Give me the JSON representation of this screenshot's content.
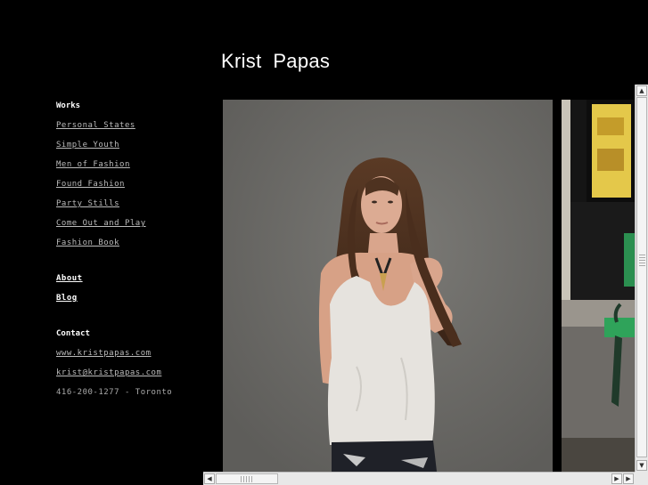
{
  "header": {
    "title": "Krist  Papas"
  },
  "sidebar": {
    "works_heading": "Works",
    "works": [
      {
        "label": "Personal States"
      },
      {
        "label": "Simple Youth"
      },
      {
        "label": "Men of Fashion"
      },
      {
        "label": "Found Fashion"
      },
      {
        "label": "Party Stills"
      },
      {
        "label": "Come Out and Play"
      },
      {
        "label": "Fashion Book"
      }
    ],
    "about_label": "About",
    "blog_label": "Blog",
    "contact_heading": "Contact",
    "website": "www.kristpapas.com",
    "email": "krist@kristpapas.com",
    "phone_city": "416-200-1277 - Toronto"
  },
  "colors": {
    "background": "#000000",
    "photo_wall": "#6f6e6b",
    "bench_green": "#2fa35a"
  },
  "icons": [
    "scroll-up-arrow-icon",
    "scroll-down-arrow-icon",
    "scroll-left-arrow-icon",
    "scroll-right-arrow-icon"
  ]
}
